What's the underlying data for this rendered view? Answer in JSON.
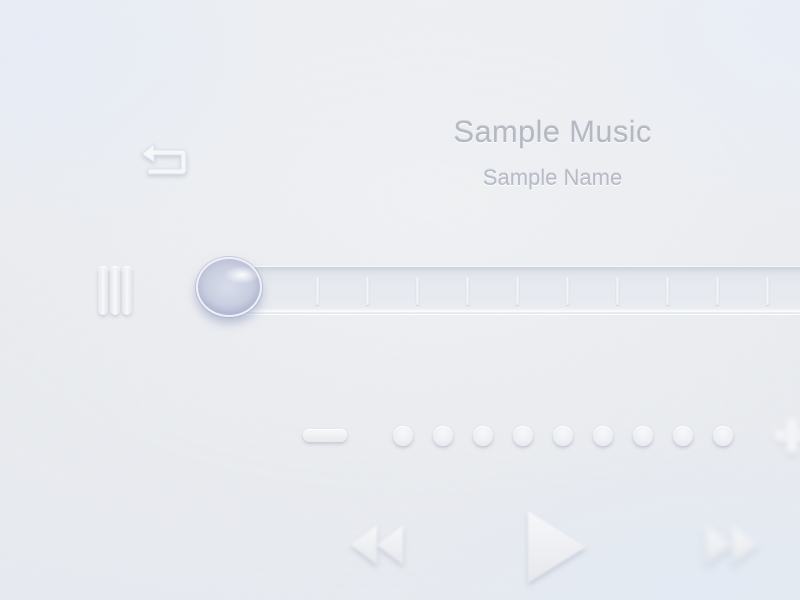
{
  "now_playing": {
    "title": "Sample Music",
    "artist": "Sample Name"
  },
  "icons": {
    "back": "return-arrow-icon",
    "menu": "menu-bars-icon",
    "volume_down": "minus-icon",
    "volume_up": "plus-icon",
    "rewind": "rewind-icon",
    "play": "play-icon",
    "forward": "fast-forward-icon"
  },
  "progress": {
    "value_percent": 0,
    "tick_count": 10
  },
  "volume": {
    "level_dots_total": 9
  },
  "colors": {
    "background": "#eaecef",
    "text": "#b5b9c4",
    "thumb": "#c9cee0"
  }
}
